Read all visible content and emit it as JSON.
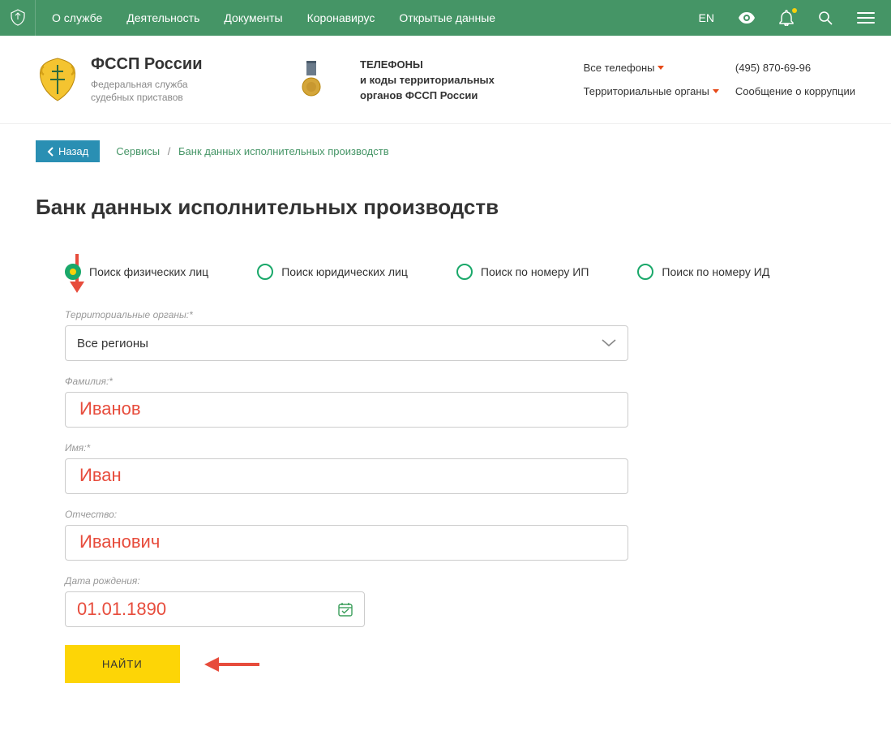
{
  "topnav": {
    "items": [
      "О службе",
      "Деятельность",
      "Документы",
      "Коронавирус",
      "Открытые данные"
    ],
    "lang": "EN"
  },
  "header": {
    "title": "ФССП России",
    "subtitle": "Федеральная служба судебных приставов",
    "phones_block": {
      "l1": "ТЕЛЕФОНЫ",
      "l2": "и коды территориальных",
      "l3": "органов ФССП России"
    },
    "dd1": "Все телефоны",
    "dd2": "Территориальные органы",
    "phone": "(495) 870-69-96",
    "corruption": "Сообщение о коррупции"
  },
  "back_label": "Назад",
  "breadcrumbs": {
    "a": "Сервисы",
    "b": "Банк данных исполнительных производств"
  },
  "page_title": "Банк данных исполнительных производств",
  "radios": {
    "r1": "Поиск физических лиц",
    "r2": "Поиск юридических лиц",
    "r3": "Поиск по номеру ИП",
    "r4": "Поиск по номеру ИД"
  },
  "form": {
    "region_label": "Территориальные органы:*",
    "region_value": "Все регионы",
    "lastname_label": "Фамилия:*",
    "lastname_value": "Иванов",
    "firstname_label": "Имя:*",
    "firstname_value": "Иван",
    "middlename_label": "Отчество:",
    "middlename_value": "Иванович",
    "dob_label": "Дата рождения:",
    "dob_value": "01.01.1890",
    "submit": "НАЙТИ"
  }
}
